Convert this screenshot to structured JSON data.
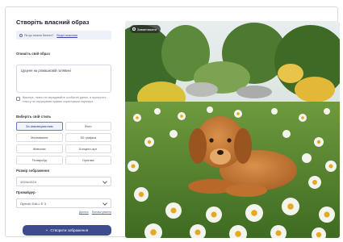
{
  "panel": {
    "title": "Створіть власний образ",
    "notice_text": "Як що можна бачити?",
    "notice_link": "Вхідні можлива",
    "describe_label": "Опишіть свій образ",
    "prompt_value": "Цуценя на ромашковій галявині",
    "consent_text": "Виконує, певно не передавайте особистої даних, а пропустіть тексту не порушувати правил користувача партнера",
    "style_label": "Виберіть свій стиль",
    "styles": [
      {
        "label": "За замовчуванням"
      },
      {
        "label": "Фото"
      },
      {
        "label": "Малювання"
      },
      {
        "label": "3D графіка"
      },
      {
        "label": "Живопис"
      },
      {
        "label": "Концепт-арт"
      },
      {
        "label": "Поларойд"
      },
      {
        "label": "Оригамі"
      }
    ],
    "size_label": "Розмір зображення",
    "size_value": "1024x1024",
    "provider_label": "Провайдер",
    "provider_value": "OpenAI DALL·E 3",
    "link_one": "Далеко",
    "link_two": "Налаштування",
    "generate_button": "Створити зображення"
  },
  "image": {
    "badge": "Завантажити"
  }
}
